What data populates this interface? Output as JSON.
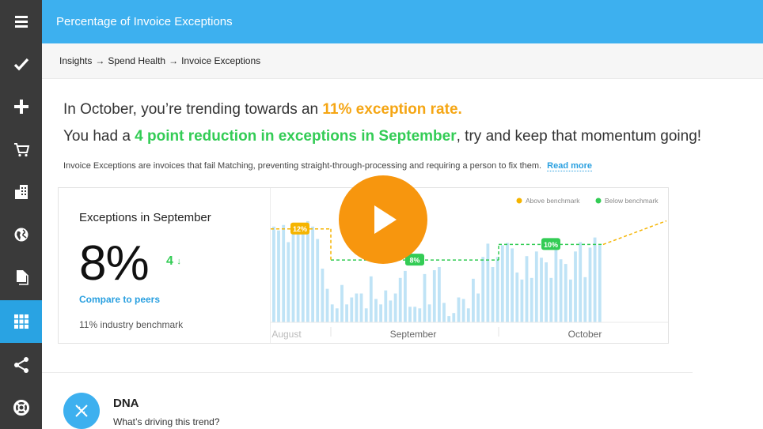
{
  "header": {
    "title": "Percentage of Invoice Exceptions"
  },
  "breadcrumb": {
    "items": [
      "Insights",
      "Spend Health",
      "Invoice Exceptions"
    ],
    "separator": "→"
  },
  "sidebar": {
    "items": [
      {
        "icon": "hamburger-icon",
        "active": false
      },
      {
        "icon": "check-icon",
        "active": false
      },
      {
        "icon": "plus-icon",
        "active": false
      },
      {
        "icon": "cart-icon",
        "active": false
      },
      {
        "icon": "building-icon",
        "active": false
      },
      {
        "icon": "globe-icon",
        "active": false
      },
      {
        "icon": "documents-icon",
        "active": false
      },
      {
        "icon": "grid-icon",
        "active": true
      },
      {
        "icon": "share-icon",
        "active": false
      },
      {
        "icon": "lifebuoy-icon",
        "active": false
      }
    ]
  },
  "headline": {
    "line1_prefix": "In October, you’re trending towards an ",
    "line1_highlight": "11% exception rate.",
    "line2_prefix": "You had a ",
    "line2_highlight": "4 point reduction in exceptions in September",
    "line2_suffix": ", try and keep that momentum going!"
  },
  "description": {
    "text": "Invoice Exceptions are invoices that fail Matching, preventing straight-through-processing and requiring a person to fix them.",
    "link": "Read more"
  },
  "summary": {
    "title": "Exceptions in September",
    "value": "8%",
    "delta": "4",
    "delta_arrow": "↓",
    "compare_link": "Compare to peers",
    "benchmark": "11% industry benchmark"
  },
  "chart_data": {
    "type": "bar",
    "ylim": [
      0,
      14
    ],
    "y_ticks": [
      "14%",
      "0%"
    ],
    "months": [
      "August",
      "September",
      "October"
    ],
    "legend": [
      {
        "label": "Above benchmark",
        "color": "#f5b400"
      },
      {
        "label": "Below benchmark",
        "color": "#33cc55"
      }
    ],
    "month_averages": [
      {
        "month": "August",
        "value": 12,
        "label": "12%",
        "color": "#f5b400"
      },
      {
        "month": "September",
        "value": 8,
        "label": "8%",
        "color": "#33cc55"
      },
      {
        "month": "October",
        "value": 10,
        "label": "10%",
        "color": "#33cc55"
      }
    ],
    "values": [
      12.3,
      11.8,
      12.5,
      10.3,
      12.0,
      11.5,
      12.4,
      13.0,
      12.3,
      10.7,
      6.9,
      4.3,
      2.3,
      1.8,
      4.8,
      2.3,
      3.2,
      3.7,
      3.7,
      1.8,
      5.9,
      3.0,
      2.3,
      4.1,
      2.8,
      3.7,
      5.7,
      6.6,
      2.0,
      2.0,
      1.8,
      6.2,
      2.3,
      6.7,
      7.1,
      2.5,
      0.8,
      1.2,
      3.2,
      3.0,
      1.8,
      5.6,
      3.7,
      8.4,
      10.1,
      7.1,
      8.4,
      9.9,
      10.2,
      9.5,
      6.4,
      5.5,
      8.5,
      5.7,
      9.1,
      8.3,
      7.7,
      5.7,
      9.6,
      8.1,
      7.5,
      5.5,
      9.1,
      10.3,
      5.8,
      9.6,
      10.9,
      9.9
    ],
    "trend_line": {
      "from": 10.0,
      "to": 10.8
    },
    "bar_color": "#bfe3f6"
  },
  "dna": {
    "title": "DNA",
    "subtitle": "What’s driving this trend?"
  },
  "colors": {
    "accent": "#3db0ef",
    "sidebar": "#3a3a3a",
    "orange": "#f5a614",
    "green": "#33cc55",
    "play": "#f7960e"
  }
}
